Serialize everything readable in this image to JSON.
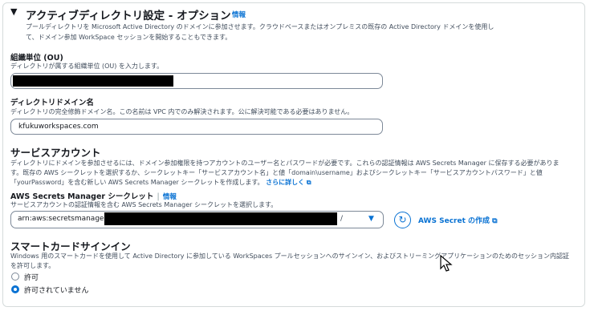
{
  "section": {
    "title": "アクティブディレクトリ設定 - オプション",
    "info_link": "情報",
    "desc1": "プールディレクトリを Microsoft Active Directory のドメインに参加させます。クラウドベースまたはオンプレミスの既存の Active Directory ドメインを使用し",
    "desc2": "て、ドメイン参加 WorkSpace セッションを開始することもできます。"
  },
  "ou": {
    "label": "組織単位 (OU)",
    "hint": "ディレクトリが属する組織単位 (OU) を入力します。",
    "value": ""
  },
  "domain": {
    "label": "ディレクトリドメイン名",
    "hint": "ディレクトリの完全修飾ドメイン名。この名前は VPC 内でのみ解決されます。公に解決可能である必要はありません。",
    "value": "kfukuworkspaces.com"
  },
  "service_account": {
    "title": "サービスアカウント",
    "desc1": "ディレクトリにドメインを参加させるには、ドメイン参加権限を持つアカウントのユーザー名とパスワードが必要です。これらの認証情報は AWS Secrets Manager に保存する必要がありま",
    "desc2": "す。既存の AWS シークレットを選択するか、シークレットキー「サービスアカウント名」と値「domain\\username」およびシークレットキー「サービスアカウントパスワード」と値",
    "desc3": "「yourPassword」を含む新しい AWS Secrets Manager シークレットを作成します。",
    "learn_more": "さらに詳しく",
    "secret_label": "AWS Secrets Manager シークレット",
    "secret_info": "情報",
    "secret_hint": "サービスアカウントの認証情報を含む AWS Secrets Manager シークレットを選択します。",
    "secret_value_prefix": "arn:aws:secretsmanager:",
    "secret_value_suffix": "/",
    "create_secret": "AWS Secret の作成"
  },
  "smartcard": {
    "title": "スマートカードサインイン",
    "desc1": "Windows 用のスマートカードを使用して Active Directory に参加している WorkSpaces プールセッションへのサインイン、およびストリーミングアプリケーションのためのセッション内認証",
    "desc2": "を許可します。",
    "options": [
      "許可",
      "許可されていません"
    ],
    "selected": "許可されていません"
  }
}
